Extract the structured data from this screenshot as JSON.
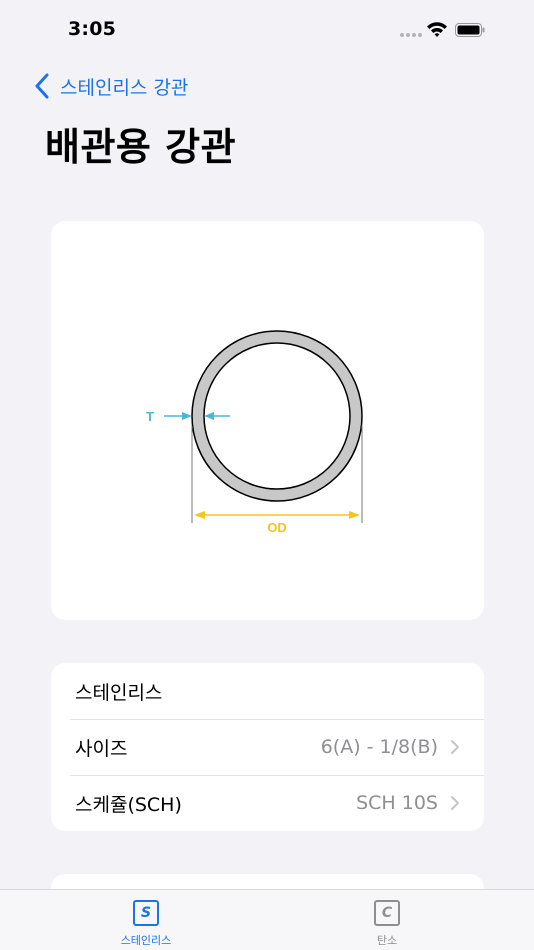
{
  "status_bar": {
    "time": "3:05"
  },
  "nav": {
    "back_label": "스테인리스 강관",
    "title": "배관용 강관"
  },
  "diagram": {
    "thickness_label": "T",
    "od_label": "OD"
  },
  "settings": {
    "material_label": "스테인리스",
    "rows": [
      {
        "label": "사이즈",
        "value": "6(A) - 1/8(B)"
      },
      {
        "label": "스케쥴(SCH)",
        "value": "SCH 10S"
      }
    ]
  },
  "tab_bar": {
    "tabs": [
      {
        "glyph": "S",
        "label": "스테인리스",
        "selected": true
      },
      {
        "glyph": "C",
        "label": "탄소",
        "selected": false
      }
    ]
  },
  "colors": {
    "accent": "#1a73e8",
    "thickness": "#4ab6d8",
    "outer_diameter": "#f5c518",
    "pipe_wall": "#c8c8c8"
  }
}
